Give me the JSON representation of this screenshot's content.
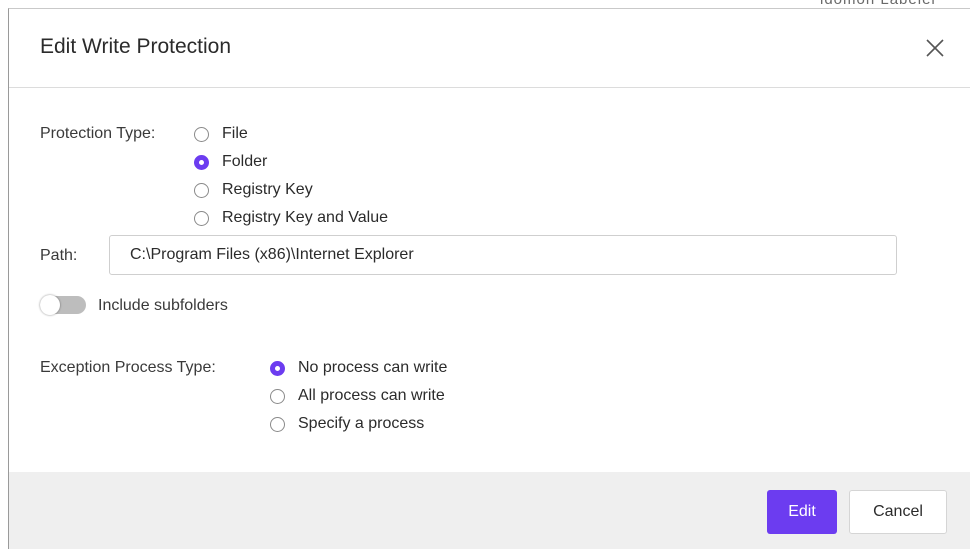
{
  "background_text": "ldomon Labeler",
  "dialog": {
    "title": "Edit Write Protection",
    "close_icon": "close-icon"
  },
  "protection_type": {
    "label": "Protection Type:",
    "options": [
      {
        "label": "File",
        "checked": false
      },
      {
        "label": "Folder",
        "checked": true
      },
      {
        "label": "Registry Key",
        "checked": false
      },
      {
        "label": "Registry Key and Value",
        "checked": false
      }
    ]
  },
  "path": {
    "label": "Path:",
    "value": "C:\\Program Files (x86)\\Internet Explorer",
    "placeholder": ""
  },
  "include_subfolders": {
    "label": "Include subfolders",
    "enabled": false
  },
  "exception_process_type": {
    "label": "Exception Process Type:",
    "options": [
      {
        "label": "No process can write",
        "checked": true
      },
      {
        "label": "All process can write",
        "checked": false
      },
      {
        "label": "Specify a process",
        "checked": false
      }
    ]
  },
  "footer": {
    "edit_label": "Edit",
    "cancel_label": "Cancel"
  },
  "colors": {
    "accent": "#6c3cf0",
    "footer_bg": "#efefef",
    "toggle_off": "#bdbdbd"
  }
}
